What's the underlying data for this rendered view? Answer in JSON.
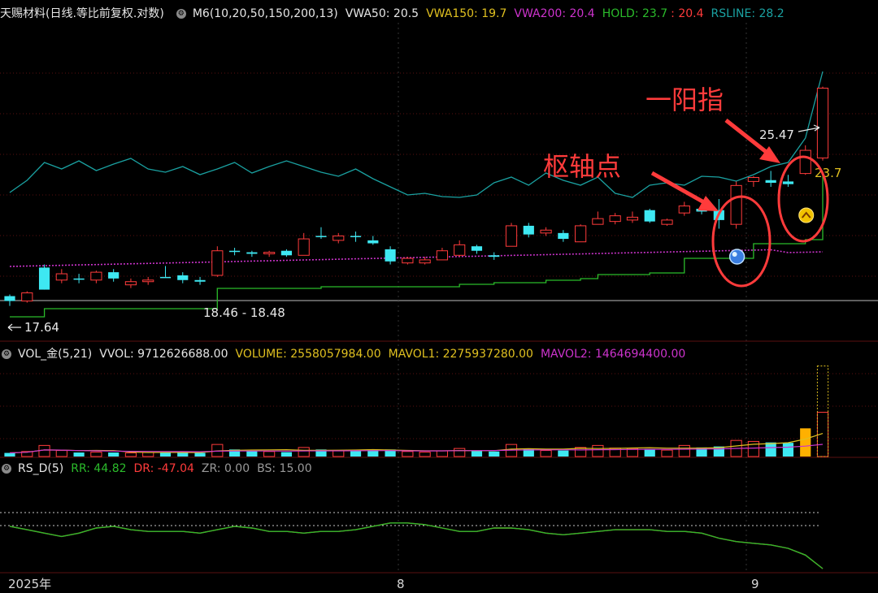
{
  "main_panel": {
    "stock_name": "天赐材料(日线.等比前复权.对数)",
    "indicator": "M6(10,20,50,150,200,13)",
    "vwa50": "VWA50: 20.5",
    "vwa150": "VWA150: 19.7",
    "vwa200": "VWA200: 20.4",
    "hold": "HOLD: 23.7",
    "hold2": ": 20.4",
    "rsline": "RSLINE: 28.2"
  },
  "volume_panel": {
    "name": "VOL_金(5,21)",
    "vvol": "VVOL: 9712626688.00",
    "volume": "VOLUME: 2558057984.00",
    "mavol1": "MAVOL1: 2275937280.00",
    "mavol2": "MAVOL2: 1464694400.00"
  },
  "rsd_panel": {
    "name": "RS_D(5)",
    "rr": "RR: 44.82",
    "dr": "DR: -47.04",
    "zr": "ZR: 0.00",
    "bs": "BS: 15.00"
  },
  "annotations": {
    "pivot": "枢轴点",
    "one_yang": "一阳指"
  },
  "colors": {
    "up": "#ff3b3b",
    "down": "#3ee8f2",
    "rsline": "#1aa1a1",
    "hold": "#2bbb2b",
    "vwa200": "#cc33cc",
    "vwa150": "#e0c020",
    "white": "#e8e8e8"
  },
  "chart_data": {
    "type": "candlestick",
    "x_axis_labels": [
      "2025年",
      "8",
      "9"
    ],
    "price_labels": {
      "low": "17.64",
      "range": "18.46 - 18.48",
      "high": "25.47",
      "hold": "23.7"
    },
    "candles": [
      {
        "o": 17.55,
        "h": 17.75,
        "l": 17.4,
        "c": 17.7,
        "up": false
      },
      {
        "o": 17.55,
        "h": 17.85,
        "l": 17.5,
        "c": 17.8,
        "up": true
      },
      {
        "o": 17.9,
        "h": 18.7,
        "l": 17.9,
        "c": 18.6,
        "up": false
      },
      {
        "o": 18.4,
        "h": 18.55,
        "l": 18.1,
        "c": 18.2,
        "up": true
      },
      {
        "o": 18.25,
        "h": 18.4,
        "l": 18.1,
        "c": 18.25,
        "up": false
      },
      {
        "o": 18.2,
        "h": 18.5,
        "l": 18.1,
        "c": 18.45,
        "up": true
      },
      {
        "o": 18.45,
        "h": 18.55,
        "l": 18.15,
        "c": 18.25,
        "up": false
      },
      {
        "o": 18.15,
        "h": 18.25,
        "l": 17.95,
        "c": 18.05,
        "up": true
      },
      {
        "o": 18.15,
        "h": 18.3,
        "l": 18.05,
        "c": 18.2,
        "up": true
      },
      {
        "o": 18.3,
        "h": 18.65,
        "l": 18.3,
        "c": 18.3,
        "up": false
      },
      {
        "o": 18.35,
        "h": 18.45,
        "l": 18.1,
        "c": 18.2,
        "up": false
      },
      {
        "o": 18.15,
        "h": 18.3,
        "l": 18.05,
        "c": 18.2,
        "up": false
      },
      {
        "o": 18.35,
        "h": 19.3,
        "l": 18.3,
        "c": 19.15,
        "up": true
      },
      {
        "o": 19.15,
        "h": 19.25,
        "l": 19.0,
        "c": 19.15,
        "up": false
      },
      {
        "o": 19.05,
        "h": 19.15,
        "l": 18.95,
        "c": 19.1,
        "up": false
      },
      {
        "o": 19.05,
        "h": 19.15,
        "l": 18.95,
        "c": 19.1,
        "up": true
      },
      {
        "o": 19.15,
        "h": 19.2,
        "l": 18.95,
        "c": 19.0,
        "up": false
      },
      {
        "o": 19.0,
        "h": 19.75,
        "l": 19.0,
        "c": 19.55,
        "up": true
      },
      {
        "o": 19.65,
        "h": 19.95,
        "l": 19.55,
        "c": 19.65,
        "up": false
      },
      {
        "o": 19.5,
        "h": 19.75,
        "l": 19.4,
        "c": 19.65,
        "up": true
      },
      {
        "o": 19.65,
        "h": 19.8,
        "l": 19.45,
        "c": 19.65,
        "up": false
      },
      {
        "o": 19.5,
        "h": 19.65,
        "l": 19.35,
        "c": 19.4,
        "up": false
      },
      {
        "o": 19.2,
        "h": 19.3,
        "l": 18.7,
        "c": 18.8,
        "up": false
      },
      {
        "o": 18.75,
        "h": 18.95,
        "l": 18.7,
        "c": 18.9,
        "up": true
      },
      {
        "o": 18.75,
        "h": 18.95,
        "l": 18.7,
        "c": 18.85,
        "up": true
      },
      {
        "o": 18.85,
        "h": 19.25,
        "l": 18.85,
        "c": 19.15,
        "up": true
      },
      {
        "o": 19.0,
        "h": 19.5,
        "l": 18.95,
        "c": 19.35,
        "up": true
      },
      {
        "o": 19.3,
        "h": 19.35,
        "l": 19.05,
        "c": 19.15,
        "up": false
      },
      {
        "o": 19.0,
        "h": 19.1,
        "l": 18.85,
        "c": 18.95,
        "up": false
      },
      {
        "o": 19.3,
        "h": 20.1,
        "l": 19.3,
        "c": 20.0,
        "up": true
      },
      {
        "o": 20.0,
        "h": 20.1,
        "l": 19.6,
        "c": 19.7,
        "up": false
      },
      {
        "o": 19.75,
        "h": 19.95,
        "l": 19.65,
        "c": 19.85,
        "up": true
      },
      {
        "o": 19.75,
        "h": 19.85,
        "l": 19.45,
        "c": 19.55,
        "up": false
      },
      {
        "o": 19.45,
        "h": 20.05,
        "l": 19.45,
        "c": 20.0,
        "up": true
      },
      {
        "o": 20.05,
        "h": 20.5,
        "l": 20.05,
        "c": 20.25,
        "up": true
      },
      {
        "o": 20.15,
        "h": 20.45,
        "l": 20.05,
        "c": 20.35,
        "up": true
      },
      {
        "o": 20.2,
        "h": 20.5,
        "l": 20.1,
        "c": 20.3,
        "up": true
      },
      {
        "o": 20.55,
        "h": 20.6,
        "l": 20.1,
        "c": 20.15,
        "up": false
      },
      {
        "o": 20.05,
        "h": 20.25,
        "l": 20.0,
        "c": 20.2,
        "up": true
      },
      {
        "o": 20.45,
        "h": 20.85,
        "l": 20.35,
        "c": 20.7,
        "up": true
      },
      {
        "o": 20.5,
        "h": 20.75,
        "l": 20.4,
        "c": 20.6,
        "up": false
      },
      {
        "o": 20.55,
        "h": 20.95,
        "l": 19.9,
        "c": 20.2,
        "up": false
      },
      {
        "o": 20.05,
        "h": 21.6,
        "l": 19.9,
        "c": 21.45,
        "up": true
      },
      {
        "o": 21.6,
        "h": 21.8,
        "l": 21.4,
        "c": 21.75,
        "up": true
      },
      {
        "o": 21.65,
        "h": 22.0,
        "l": 21.4,
        "c": 21.55,
        "up": false
      },
      {
        "o": 21.5,
        "h": 21.85,
        "l": 21.4,
        "c": 21.6,
        "up": false
      },
      {
        "o": 21.9,
        "h": 23.0,
        "l": 21.85,
        "c": 22.8,
        "up": true
      },
      {
        "o": 22.5,
        "h": 25.47,
        "l": 22.4,
        "c": 25.4,
        "up": true
      }
    ],
    "volume": {
      "values": [
        0.18,
        0.25,
        0.55,
        0.3,
        0.2,
        0.22,
        0.2,
        0.18,
        0.2,
        0.22,
        0.2,
        0.18,
        0.6,
        0.35,
        0.28,
        0.25,
        0.22,
        0.45,
        0.35,
        0.3,
        0.3,
        0.32,
        0.35,
        0.25,
        0.22,
        0.28,
        0.4,
        0.3,
        0.25,
        0.6,
        0.38,
        0.3,
        0.3,
        0.45,
        0.55,
        0.42,
        0.4,
        0.38,
        0.32,
        0.55,
        0.45,
        0.5,
        0.8,
        0.75,
        0.7,
        0.68,
        1.4,
        2.2
      ],
      "up_flags": [
        false,
        true,
        true,
        true,
        false,
        true,
        false,
        true,
        true,
        false,
        false,
        false,
        true,
        false,
        false,
        true,
        false,
        true,
        false,
        true,
        false,
        false,
        false,
        true,
        true,
        true,
        true,
        false,
        false,
        true,
        false,
        true,
        false,
        true,
        true,
        true,
        true,
        false,
        true,
        true,
        false,
        false,
        true,
        true,
        false,
        false,
        true,
        true
      ],
      "vvol_last": 4.5
    },
    "rs_d": {
      "rr": [
        0.55,
        0.45,
        0.35,
        0.25,
        0.35,
        0.5,
        0.55,
        0.45,
        0.4,
        0.4,
        0.4,
        0.35,
        0.45,
        0.55,
        0.5,
        0.4,
        0.4,
        0.35,
        0.4,
        0.4,
        0.45,
        0.55,
        0.65,
        0.65,
        0.6,
        0.5,
        0.4,
        0.4,
        0.5,
        0.5,
        0.45,
        0.35,
        0.3,
        0.35,
        0.4,
        0.45,
        0.45,
        0.45,
        0.4,
        0.4,
        0.35,
        0.2,
        0.1,
        0.05,
        0.0,
        -0.1,
        -0.3,
        -0.7
      ],
      "dr": [
        0.45,
        0.55,
        0.65,
        0.75,
        0.65,
        0.5,
        0.45,
        0.55,
        0.6,
        0.6,
        0.6,
        0.65,
        0.55,
        0.45,
        0.5,
        0.6,
        0.6,
        0.65,
        0.6,
        0.6,
        0.55,
        0.45,
        0.35,
        0.35,
        0.4,
        0.5,
        0.6,
        0.6,
        0.5,
        0.5,
        0.55,
        0.65,
        0.7,
        0.65,
        0.6,
        0.55,
        0.55,
        0.55,
        0.6,
        0.6,
        0.65,
        0.8,
        0.9,
        0.95,
        1.0,
        1.1,
        1.3,
        1.7
      ]
    }
  }
}
